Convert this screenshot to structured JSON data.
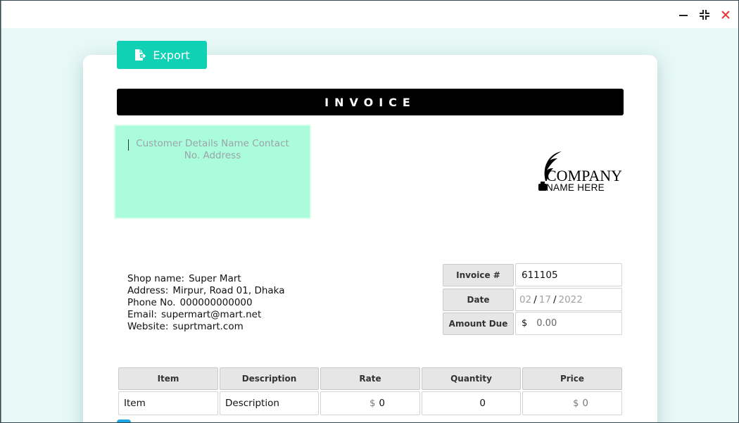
{
  "window": {
    "controls": {
      "minimize_icon": "minimize-icon",
      "restore_icon": "restore-icon",
      "close_icon": "close-icon"
    },
    "close_color": "#e53935"
  },
  "toolbar": {
    "export_label": "Export",
    "export_icon": "file-export-icon",
    "accent": "#11d1b5"
  },
  "invoice": {
    "title": "INVOICE",
    "customer_placeholder": "Customer Details  Name  Contact No.  Address",
    "customer_bg": "#abfcdc",
    "logo": {
      "line1": "COMPANY",
      "line2": "NAME HERE"
    }
  },
  "shop": {
    "name_label": "Shop name:",
    "name_value": "Super Mart",
    "address_label": "Address:",
    "address_value": "Mirpur, Road 01, Dhaka",
    "phone_label": "Phone No.",
    "phone_value": "000000000000",
    "email_label": "Email:",
    "email_value": "supermart@mart.net",
    "website_label": "Website:",
    "website_value": "suprtmart.com"
  },
  "meta": {
    "invoice_no_label": "Invoice #",
    "invoice_no_value": "611105",
    "date_label": "Date",
    "date_month": "02",
    "date_day": "17",
    "date_year": "2022",
    "date_sep": "/",
    "amount_label": "Amount Due",
    "amount_currency": "$",
    "amount_value": "0.00"
  },
  "table": {
    "headers": [
      "Item",
      "Description",
      "Rate",
      "Quantity",
      "Price"
    ],
    "rows": [
      {
        "item": "Item",
        "description": "Description",
        "rate_currency": "$",
        "rate": "0",
        "quantity": "0",
        "price_currency": "$",
        "price": "0"
      }
    ]
  }
}
